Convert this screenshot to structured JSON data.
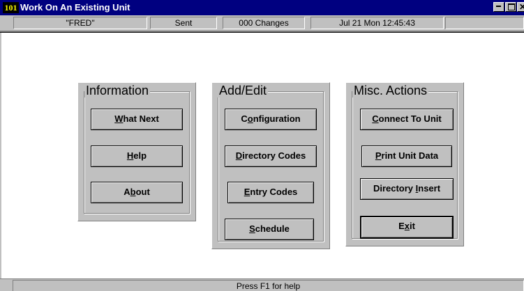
{
  "window": {
    "icon_label": "101",
    "title": "Work On An Existing Unit",
    "controls": {
      "minimize": "minimize",
      "maximize": "maximize",
      "close": "close"
    }
  },
  "status_top": {
    "unit_name": "\"FRED\"",
    "state": "Sent",
    "changes": "000 Changes",
    "datetime": "Jul 21  Mon  12:45:43"
  },
  "groups": {
    "information": {
      "title": "Information",
      "buttons": [
        {
          "pre": "",
          "accel": "W",
          "post": "hat Next"
        },
        {
          "pre": "",
          "accel": "H",
          "post": "elp"
        },
        {
          "pre": "A",
          "accel": "b",
          "post": "out"
        }
      ]
    },
    "add_edit": {
      "title": "Add/Edit",
      "buttons": [
        {
          "pre": "C",
          "accel": "o",
          "post": "nfiguration"
        },
        {
          "pre": "",
          "accel": "D",
          "post": "irectory Codes"
        },
        {
          "pre": "",
          "accel": "E",
          "post": "ntry Codes"
        },
        {
          "pre": "",
          "accel": "S",
          "post": "chedule"
        }
      ]
    },
    "misc_actions": {
      "title": "Misc. Actions",
      "buttons": [
        {
          "pre": "",
          "accel": "C",
          "post": "onnect To Unit"
        },
        {
          "pre": "",
          "accel": "P",
          "post": "rint Unit Data"
        },
        {
          "pre": "Directory ",
          "accel": "I",
          "post": "nsert"
        },
        {
          "pre": "E",
          "accel": "x",
          "post": "it"
        }
      ]
    }
  },
  "status_bottom": {
    "help_text": "Press F1 for help"
  }
}
